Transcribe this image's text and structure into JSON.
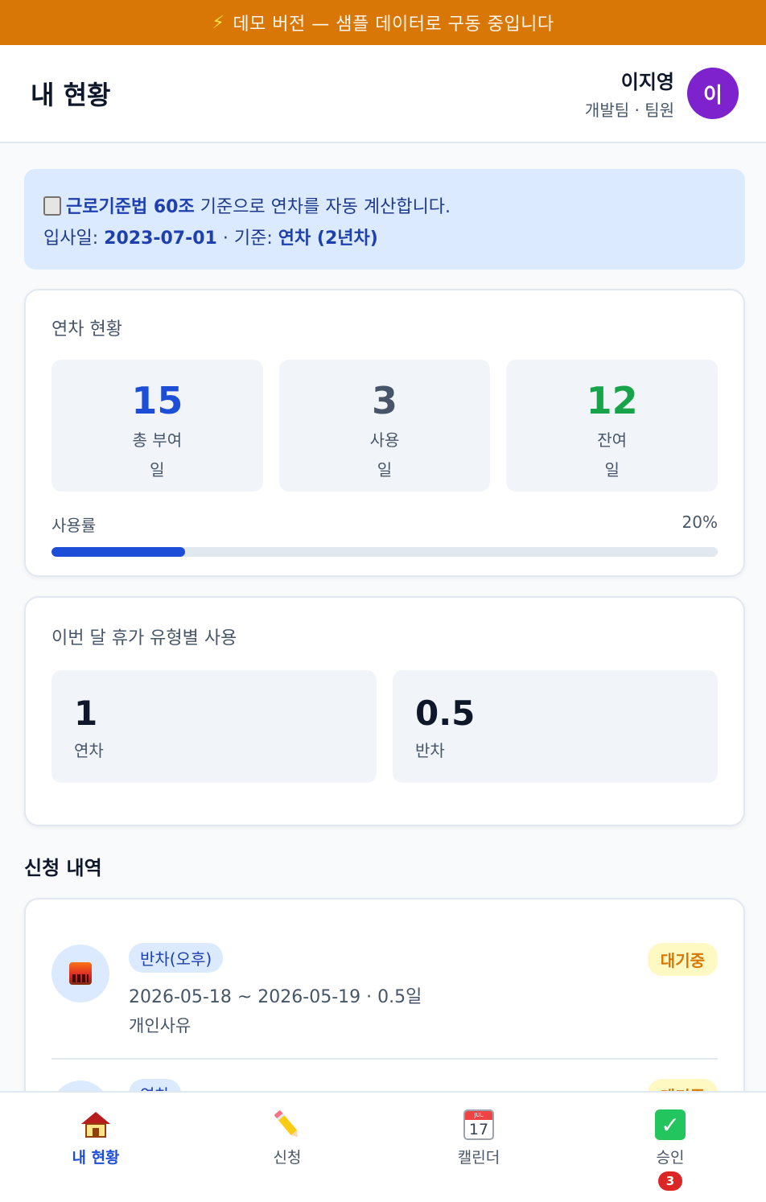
{
  "banner": {
    "text": "데모 버전 — 샘플 데이터로 구동 중입니다"
  },
  "header": {
    "title": "내 현황"
  },
  "user": {
    "name": "이지영",
    "dept": "개발팀 · 팀원",
    "avatar_initial": "이",
    "avatar_color": "#7e22ce"
  },
  "info": {
    "law": "근로기준법 60조",
    "law_suffix": " 기준으로 연차를 자동 계산합니다.",
    "join_label": "입사일: ",
    "join_date": "2023-07-01",
    "basis_label": " · 기준: ",
    "basis": "연차 (2년차)"
  },
  "annual": {
    "title": "연차 현황",
    "stats": [
      {
        "value": "15",
        "label": "총 부여",
        "unit": "일",
        "color": "#1d4ed8"
      },
      {
        "value": "3",
        "label": "사용",
        "unit": "일",
        "color": "#475569"
      },
      {
        "value": "12",
        "label": "잔여",
        "unit": "일",
        "color": "#16a34a"
      }
    ],
    "usage_label": "사용률",
    "usage_text": "20%",
    "usage_rate": 0.2
  },
  "monthly": {
    "title": "이번 달 휴가 유형별 사용",
    "items": [
      {
        "value": "1",
        "label": "연차"
      },
      {
        "value": "0.5",
        "label": "반차"
      }
    ]
  },
  "requests_title": "신청 내역",
  "requests": [
    {
      "icon": "sunset-icon",
      "type": "반차(오후)",
      "dates": "2026-05-18 ~ 2026-05-19 · 0.5일",
      "reason": "개인사유",
      "status": "대기중"
    },
    {
      "icon": "house-icon",
      "type": "연차",
      "dates": "",
      "reason": "",
      "status": "대기중"
    }
  ],
  "nav": [
    {
      "icon": "house-icon",
      "label": "내 현황",
      "active": true
    },
    {
      "icon": "pencil-icon",
      "label": "신청"
    },
    {
      "icon": "calendar-icon",
      "label": "캘린더",
      "calendar_month": "JUL",
      "calendar_day": "17"
    },
    {
      "icon": "check-icon",
      "label": "승인",
      "badge": "3"
    }
  ],
  "colors": {
    "accent": "#1d4ed8",
    "banner": "#d97706",
    "pending": "#d97706",
    "remaining": "#16a34a"
  }
}
